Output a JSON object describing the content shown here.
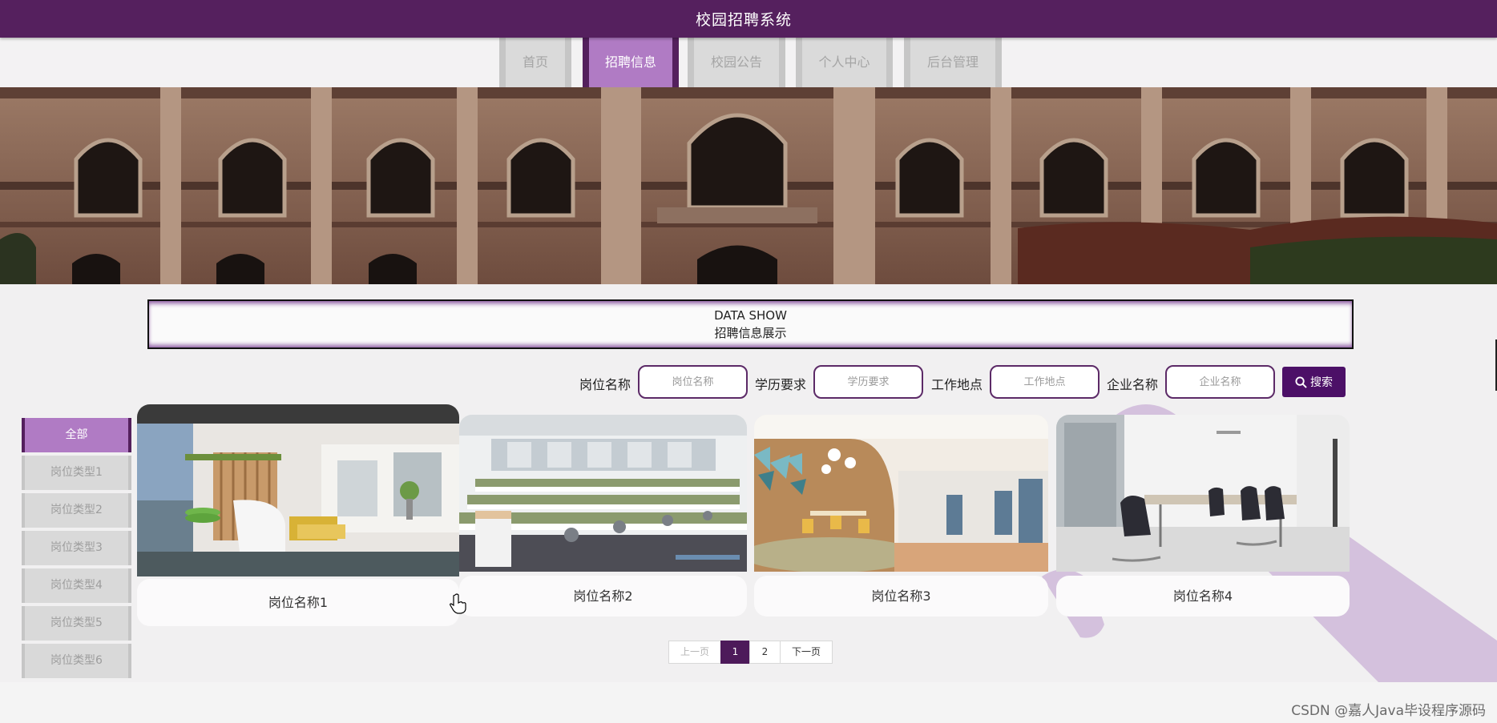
{
  "header": {
    "title": "校园招聘系统"
  },
  "nav": {
    "items": [
      "首页",
      "招聘信息",
      "校园公告",
      "个人中心",
      "后台管理"
    ],
    "active": 1
  },
  "section": {
    "title_en": "DATA SHOW",
    "title_cn": "招聘信息展示"
  },
  "search": {
    "fields": [
      {
        "label": "岗位名称",
        "placeholder": "岗位名称"
      },
      {
        "label": "学历要求",
        "placeholder": "学历要求"
      },
      {
        "label": "工作地点",
        "placeholder": "工作地点"
      },
      {
        "label": "企业名称",
        "placeholder": "企业名称"
      }
    ],
    "button": "搜索"
  },
  "categories": [
    "全部",
    "岗位类型1",
    "岗位类型2",
    "岗位类型3",
    "岗位类型4",
    "岗位类型5",
    "岗位类型6"
  ],
  "cards": [
    {
      "name": "岗位名称1",
      "image": "office-lounge-photo"
    },
    {
      "name": "岗位名称2",
      "image": "open-office-photo"
    },
    {
      "name": "岗位名称3",
      "image": "office-cafe-photo"
    },
    {
      "name": "岗位名称4",
      "image": "meeting-room-photo"
    }
  ],
  "pagination": {
    "prev": "上一页",
    "pages": [
      "1",
      "2"
    ],
    "current": "1",
    "next": "下一页"
  },
  "watermark": "CSDN @嘉人Java毕设程序源码",
  "colors": {
    "primary": "#55205e",
    "accent": "#b07bc4",
    "button": "#4c1067",
    "decor": "#d4c1dd"
  }
}
